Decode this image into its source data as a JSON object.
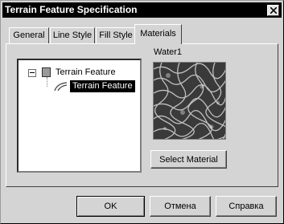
{
  "window": {
    "title": "Terrain Feature Specification"
  },
  "tabs": [
    {
      "label": "General",
      "active": false
    },
    {
      "label": "Line Style",
      "active": false
    },
    {
      "label": "Fill Style",
      "active": false
    },
    {
      "label": "Materials",
      "active": true
    }
  ],
  "tree": {
    "root_label": "Terrain Feature",
    "child_label": "Terrain Feature",
    "root_expanded": true,
    "selected": "child"
  },
  "material": {
    "name": "Water1",
    "preview_icon": "water-texture",
    "select_label": "Select Material"
  },
  "buttons": {
    "ok_label": "OK",
    "cancel_label": "Отмена",
    "help_label": "Справка"
  }
}
